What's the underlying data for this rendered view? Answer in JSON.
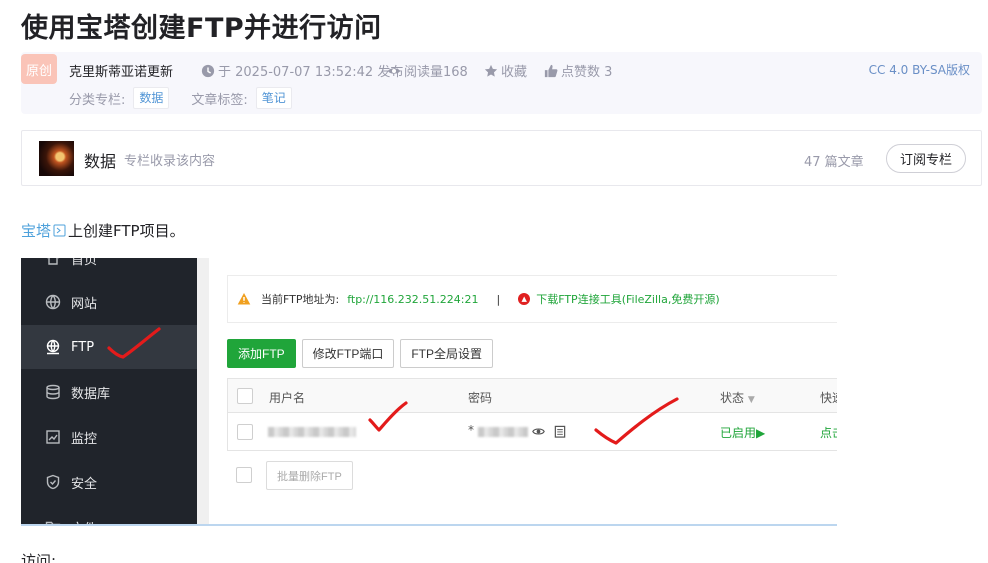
{
  "article": {
    "title": "使用宝塔创建FTP并进行访问",
    "badge": "原创",
    "author": "克里斯蒂亚诺更新",
    "published": "于 2025-07-07 13:52:42 发布",
    "views": "阅读量168",
    "favorite": "收藏",
    "likes": "点赞数 3",
    "license": "CC 4.0 BY-SA版权",
    "category_label": "分类专栏:",
    "category_tag": "数据",
    "tags_label": "文章标签:",
    "article_tag": "笔记"
  },
  "column": {
    "name": "数据",
    "desc": "专栏收录该内容",
    "count": "47 篇文章",
    "subscribe": "订阅专栏"
  },
  "body": {
    "link_text": "宝塔",
    "text_after_link": "上创建FTP项目。",
    "next_text": "访问:"
  },
  "screenshot": {
    "sidebar": [
      {
        "label": "首页",
        "icon": "home-icon"
      },
      {
        "label": "网站",
        "icon": "globe-icon"
      },
      {
        "label": "FTP",
        "icon": "ftp-globe-icon",
        "active": true
      },
      {
        "label": "数据库",
        "icon": "database-icon"
      },
      {
        "label": "监控",
        "icon": "monitor-icon"
      },
      {
        "label": "安全",
        "icon": "shield-icon"
      },
      {
        "label": "文件",
        "icon": "folder-icon"
      }
    ],
    "notice": {
      "label": "当前FTP地址为:",
      "address": "ftp://116.232.51.224:21",
      "separator": "|",
      "download": "下载FTP连接工具(FileZilla,免费开源)"
    },
    "buttons": {
      "add": "添加FTP",
      "port": "修改FTP端口",
      "global": "FTP全局设置"
    },
    "table": {
      "headers": {
        "user": "用户名",
        "password": "密码",
        "status": "状态",
        "quick": "快速"
      },
      "row": {
        "password_prefix": "*",
        "status": "已启用▶",
        "quick": "点击"
      }
    },
    "bulk_delete": "批量删除FTP"
  },
  "colors": {
    "accent_green": "#20a53a",
    "sidebar_bg": "#20242b",
    "link_blue": "#4ea1db",
    "annotation_red": "#e31b1b"
  }
}
